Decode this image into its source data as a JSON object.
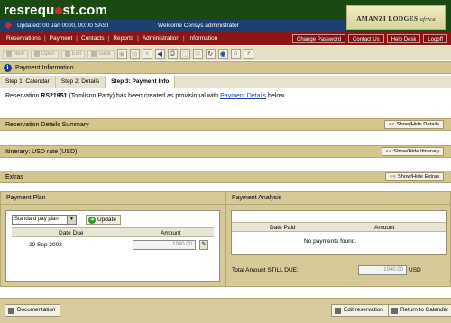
{
  "header": {
    "logo_text_a": "resrequ",
    "logo_text_b": "st.com",
    "brand_name": "AMANZI LODGES",
    "brand_sub": "africa",
    "updated": "Updated: 00 Jan 0000, 00:00 SAST",
    "welcome": "Welcome Censys administrator"
  },
  "menu": {
    "left": [
      "Reservations",
      "Payment",
      "Contacts",
      "Reports",
      "Administration",
      "Information"
    ],
    "right": [
      "Change Password",
      "Contact Us",
      "Help Desk",
      "Logoff"
    ]
  },
  "toolbar": {
    "new": "New",
    "open": "Open",
    "edit": "Edit",
    "save": "Save"
  },
  "payment_info": {
    "title": "Payment Information"
  },
  "tabs": [
    "Step 1: Calendar",
    "Step 2: Details",
    "Step 3: Payment Info"
  ],
  "message": {
    "prefix": "Reservation ",
    "code": "RS21951",
    "middle": " (Tomlison Party) has been created as provisional with ",
    "link": "Payment Details",
    "suffix": " below"
  },
  "sections": {
    "details_summary": {
      "title": "Reservation Details Summary",
      "toggle": "Show/Hide Details"
    },
    "itinerary": {
      "title": "Itinerary:  USD rate (USD)",
      "toggle": "Show/Hide Itinerary"
    },
    "extras": {
      "title": "Extras",
      "toggle": "Show/Hide Extras"
    }
  },
  "toggle_arrow": "<<",
  "payment_plan": {
    "title": "Payment Plan",
    "select_value": "Standard pay plan",
    "update_label": "Update",
    "col_date": "Date Due",
    "col_amount": "Amount",
    "rows": [
      {
        "date": "20 Sep 2003",
        "amount": "1940.00"
      }
    ]
  },
  "payment_analysis": {
    "title": "Payment Analysis",
    "col_date": "Date Paid",
    "col_amount": "Amount",
    "empty": "No payments found.",
    "total_label": "Total Amount STILL DUE:",
    "total_value": "1940.00",
    "currency": "USD"
  },
  "footer": {
    "documentation": "Documentation",
    "edit_reservation": "Edit reservation",
    "return_calendar": "Return to Calendar"
  }
}
